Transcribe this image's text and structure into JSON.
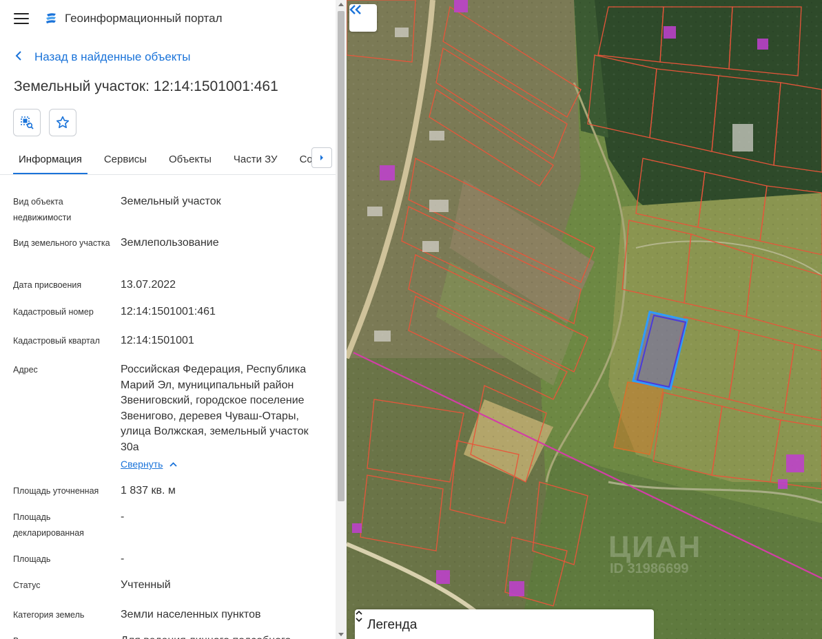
{
  "app": {
    "title": "Геоинформационный портал"
  },
  "nav": {
    "back_label": "Назад в найденные объекты"
  },
  "object": {
    "title": "Земельный участок: 12:14:1501001:461"
  },
  "tabs": [
    {
      "label": "Информация",
      "active": true
    },
    {
      "label": "Сервисы"
    },
    {
      "label": "Объекты"
    },
    {
      "label": "Части ЗУ"
    },
    {
      "label": "Соста"
    }
  ],
  "props": {
    "object_type": {
      "label": "Вид объекта недвижимости",
      "value": "Земельный участок"
    },
    "land_type": {
      "label": "Вид земельного участка",
      "value": "Землепользование"
    },
    "assign_date": {
      "label": "Дата присвоения",
      "value": "13.07.2022"
    },
    "cad_number": {
      "label": "Кадастровый номер",
      "value": "12:14:1501001:461"
    },
    "cad_quarter": {
      "label": "Кадастровый квартал",
      "value": "12:14:1501001"
    },
    "address": {
      "label": "Адрес",
      "value": "Российская Федерация, Республика Марий Эл, муниципальный район Звениговский, городское поселение Звенигово, деревея Чуваш-Отары, улица Волжская, земельный участок 30а",
      "collapse_label": "Свернуть"
    },
    "area_precise": {
      "label": "Площадь уточненная",
      "value": "1 837 кв. м"
    },
    "area_declared": {
      "label": "Площадь декларированная",
      "value": "-"
    },
    "area": {
      "label": "Площадь",
      "value": "-"
    },
    "status": {
      "label": "Статус",
      "value": "Учтенный"
    },
    "land_category": {
      "label": "Категория земель",
      "value": "Земли населенных пунктов"
    },
    "permitted_use": {
      "label": "Вид разрешенного",
      "value": "Для ведения личного подсобного"
    }
  },
  "map": {
    "legend_title": "Легенда",
    "watermark": "ЦИАН",
    "watermark_id": "ID 31986699"
  },
  "icons": {
    "menu": "hamburger-icon",
    "logo": "portal-logo-icon",
    "back": "chevron-left-icon",
    "tool1": "select-area-icon",
    "tool2": "star-icon",
    "tab_scroll": "chevron-right-icon",
    "map_collapse": "double-chevron-left-icon",
    "legend_toggle": "chevron-up-down-icon"
  },
  "colors": {
    "accent": "#1a73d9",
    "parcel_border": "#e8553a",
    "selected_parcel": "#3f52d6"
  }
}
